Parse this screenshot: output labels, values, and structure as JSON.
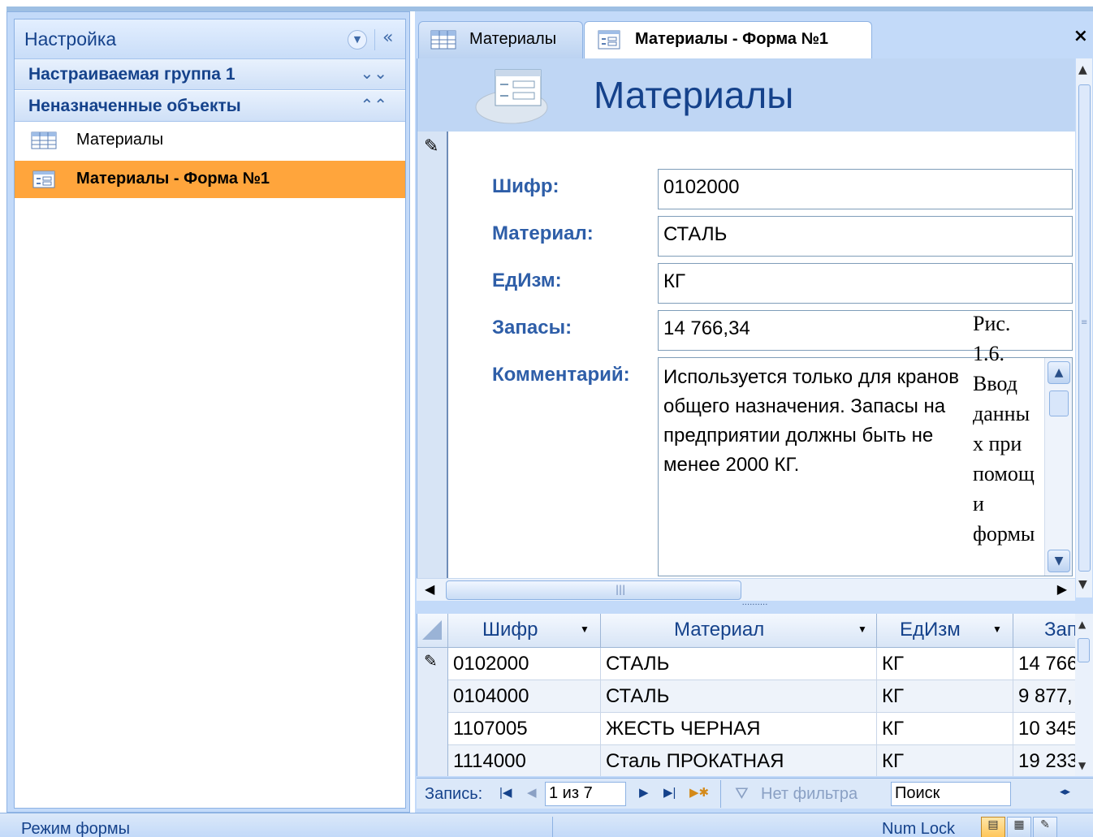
{
  "nav": {
    "title": "Настройка",
    "groups": [
      {
        "label": "Настраиваемая группа 1",
        "chevron": "≫"
      },
      {
        "label": "Неназначенные объекты",
        "chevron": "≪"
      }
    ],
    "items": [
      {
        "label": "Материалы",
        "icon": "table-icon",
        "selected": false
      },
      {
        "label": "Материалы - Форма №1",
        "icon": "form-icon",
        "selected": true
      }
    ]
  },
  "tabs": [
    {
      "label": "Материалы",
      "icon": "table-icon",
      "active": false
    },
    {
      "label": "Материалы - Форма №1",
      "icon": "form-icon",
      "active": true
    }
  ],
  "form": {
    "title": "Материалы",
    "fields": [
      {
        "label": "Шифр:",
        "value": "0102000"
      },
      {
        "label": "Материал:",
        "value": "СТАЛЬ"
      },
      {
        "label": "ЕдИзм:",
        "value": "КГ"
      },
      {
        "label": "Запасы:",
        "value": "14 766,34"
      }
    ],
    "comment_label": "Комментарий:",
    "comment_lines": [
      "Используется только для кранов",
      "общего назначения. Запасы на",
      "предприятии должны быть не",
      "менее 2000 КГ."
    ]
  },
  "caption_lines": [
    "Рис.",
    "1.6.",
    "Ввод",
    "данны",
    "х при",
    "помощ",
    "и",
    "формы"
  ],
  "datasheet": {
    "columns": [
      "Шифр",
      "Материал",
      "ЕдИзм",
      "Зап"
    ],
    "rows": [
      [
        "0102000",
        "СТАЛЬ",
        "КГ",
        "14 766"
      ],
      [
        "0104000",
        "СТАЛЬ",
        "КГ",
        "9 877,"
      ],
      [
        "1107005",
        "ЖЕСТЬ ЧЕРНАЯ",
        "КГ",
        "10 345"
      ],
      [
        "1114000",
        "Сталь ПРОКАТНАЯ",
        "КГ",
        "19 233"
      ]
    ]
  },
  "record_nav": {
    "label": "Запись:",
    "position": "1 из 7",
    "filter": "Нет фильтра",
    "search": "Поиск"
  },
  "status": {
    "mode": "Режим формы",
    "numlock": "Num Lock"
  },
  "colors": {
    "accent": "#ffa53c",
    "frame": "#c3daf9",
    "title_text": "#15428b"
  }
}
